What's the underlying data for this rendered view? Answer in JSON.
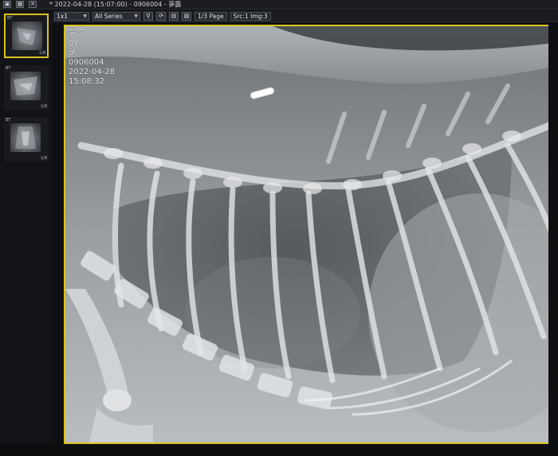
{
  "topbar": {
    "icons": [
      "window-icon",
      "grid-icon",
      "close-icon"
    ],
    "study_title": "* 2022-04-28 (15:07:00) - 0906004 - 夢露"
  },
  "toolbar": {
    "layout_value": "1x1",
    "series_value": "All Series",
    "page_label": "1/3 Page",
    "src_label": "Src:1 Img:3"
  },
  "thumbnails": [
    {
      "corner_tl": "BT",
      "corner_tr": "",
      "corner_bl": "",
      "corner_br": "1/8"
    },
    {
      "corner_tl": "BT",
      "corner_tr": "",
      "corner_bl": "",
      "corner_br": "1/8"
    },
    {
      "corner_tl": "BT",
      "corner_tr": "",
      "corner_bl": "",
      "corner_br": "1/8"
    }
  ],
  "overlay": {
    "name": "夢露",
    "age": "0Y",
    "sex": "♂",
    "patient_id": "0906004",
    "study_date": "2022-04-28",
    "study_time": "15:08:32"
  },
  "colors": {
    "active_border": "#d8c41e",
    "background": "#0e0f11",
    "toolbar": "#1a1c20"
  }
}
